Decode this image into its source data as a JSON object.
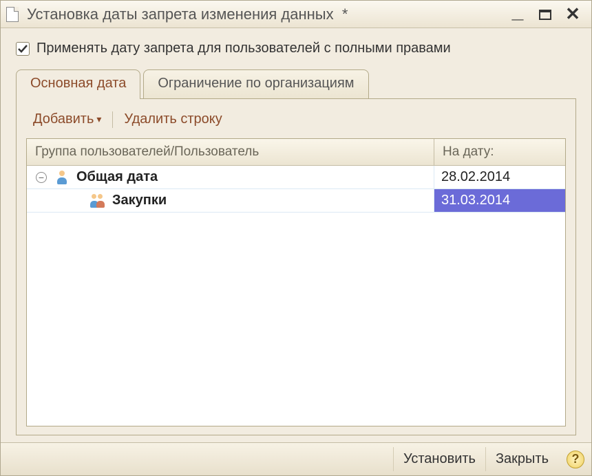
{
  "window": {
    "title": "Установка даты запрета изменения данных",
    "modified_marker": "*"
  },
  "checkbox": {
    "label": "Применять дату запрета для пользователей с полными правами",
    "checked": true
  },
  "tabs": [
    {
      "label": "Основная дата",
      "active": true
    },
    {
      "label": "Ограничение по организациям",
      "active": false
    }
  ],
  "toolbar": {
    "add_label": "Добавить",
    "delete_label": "Удалить строку"
  },
  "grid": {
    "columns": {
      "col1": "Группа пользователей/Пользователь",
      "col2": "На дату:"
    },
    "rows": [
      {
        "label": "Общая дата",
        "date": "28.02.2014",
        "level": 0,
        "bold": true,
        "icon": "user",
        "expanded": true,
        "selected": false
      },
      {
        "label": "Закупки",
        "date": "31.03.2014",
        "level": 1,
        "bold": true,
        "icon": "users",
        "expanded": false,
        "selected": true
      }
    ]
  },
  "footer": {
    "apply": "Установить",
    "close": "Закрыть",
    "help": "?"
  }
}
